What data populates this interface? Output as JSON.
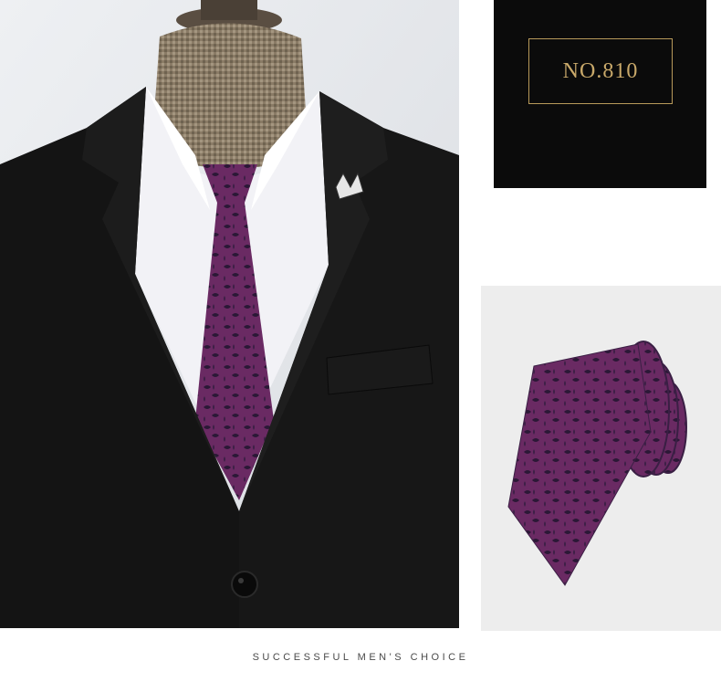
{
  "product": {
    "code": "NO.810"
  },
  "tagline": "SUCCESSFUL MEN'S CHOICE",
  "colors": {
    "tie": "#6a2a63",
    "suit": "#141414",
    "shirt": "#f2f2f6",
    "panel_dark": "#0b0b0b",
    "gold": "#c9a96a"
  }
}
